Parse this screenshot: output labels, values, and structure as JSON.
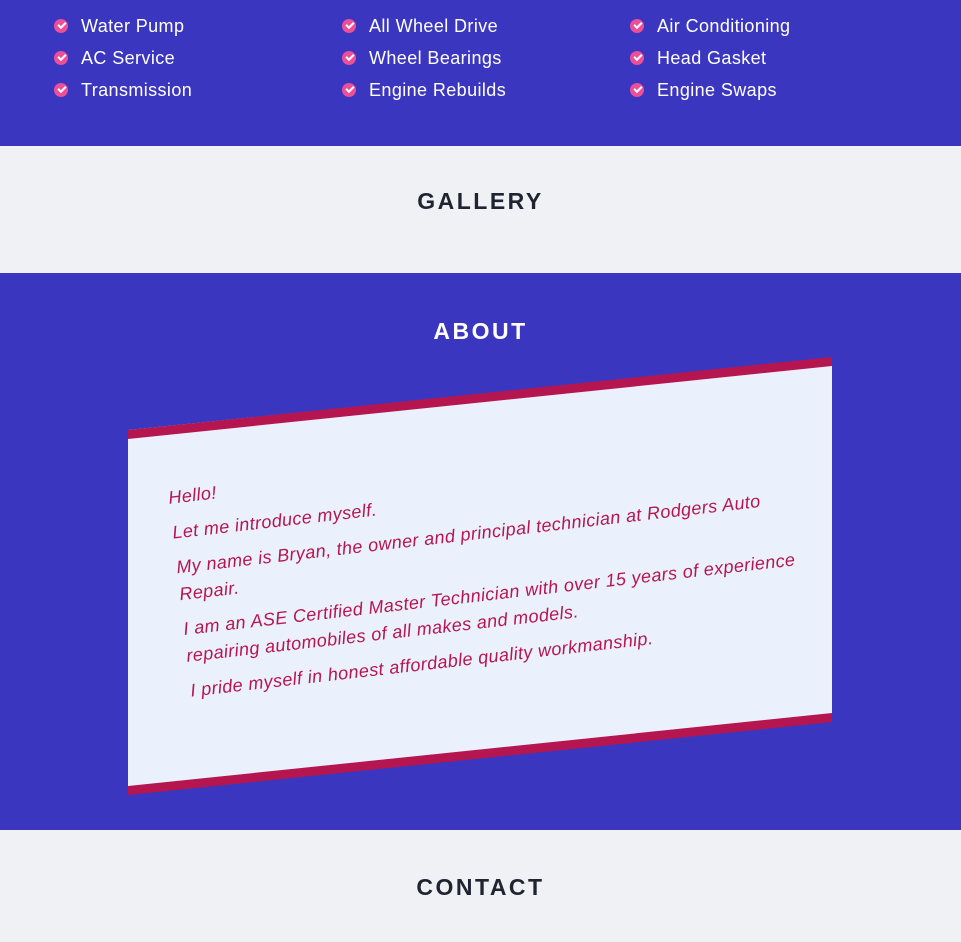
{
  "services": {
    "columns": [
      [
        "Water Pump",
        "AC Service",
        "Transmission"
      ],
      [
        "All Wheel Drive",
        "Wheel Bearings",
        "Engine Rebuilds"
      ],
      [
        "Air Conditioning",
        "Head Gasket",
        "Engine Swaps"
      ]
    ],
    "check_color": "#ec4f9a"
  },
  "gallery": {
    "title": "GALLERY"
  },
  "about": {
    "title": "ABOUT",
    "paragraphs": [
      "Hello!",
      "Let me introduce myself.",
      "My name is Bryan, the owner and principal technician at Rodgers Auto Repair.",
      "I am an ASE Certified Master Technician with over 15 years of experience repairing automobiles of all makes and models.",
      "I pride myself in honest affordable quality workmanship."
    ]
  },
  "contact": {
    "title": "CONTACT"
  },
  "colors": {
    "primary": "#3b36bf",
    "light": "#f0f1f5",
    "accent": "#b6164f",
    "card": "#eaf0fc"
  }
}
